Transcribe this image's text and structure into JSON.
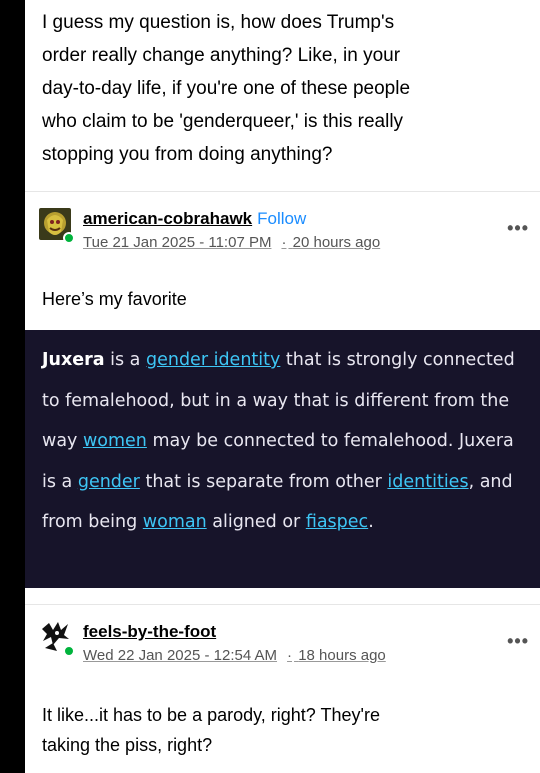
{
  "quote": {
    "lines": [
      "I guess my question is, how does Trump's",
      "order really change anything? Like, in your",
      "day-to-day life, if you're one of these people",
      "who claim to be 'genderqueer,' is this really",
      "stopping you from doing anything?"
    ]
  },
  "reply1": {
    "username": "american-cobrahawk",
    "follow_label": "Follow",
    "timestamp": "Tue 21 Jan 2025 - 11:07 PM",
    "separator": "·",
    "relative_time": "20 hours ago",
    "more_label": "•••",
    "text": "Here’s my favorite",
    "quote_block": {
      "term": "Juxera",
      "t1": " is a ",
      "l1": "gender identity",
      "t2": " that is strongly connected to femalehood, but in a way that is different from the way ",
      "l2": "women",
      "t3": " may be connected to femalehood. Juxera is a ",
      "l3": "gender",
      "t4": " that is separate from other ",
      "l4": "identities",
      "t5": ", and from being ",
      "l5": "woman",
      "t6": " aligned or ",
      "l6": "fiaspec",
      "t7": "."
    }
  },
  "reply2": {
    "username": "feels-by-the-foot",
    "timestamp": "Wed 22 Jan 2025 - 12:54 AM",
    "separator": "·",
    "relative_time": "18 hours ago",
    "more_label": "•••",
    "lines": [
      "It like...it has to be a parody, right? They're",
      "taking the piss, right?"
    ]
  },
  "colors": {
    "follow": "#1a8cff",
    "online": "#00b33c",
    "dark_bg": "#17142a",
    "dark_link": "#3ec6f5"
  }
}
